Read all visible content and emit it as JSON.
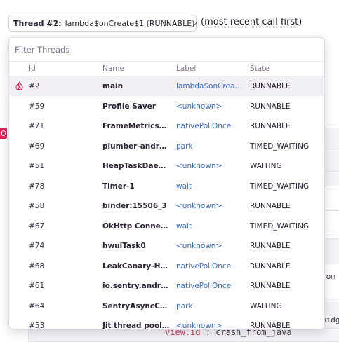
{
  "header": {
    "thread_label": "Thread #2:",
    "thread_value": "lambda$onCreate$1 (RUNNABLE)",
    "note_open": "(",
    "note_text": "most recent call first",
    "note_close": ")"
  },
  "dropdown": {
    "filter_placeholder": "Filter Threads",
    "columns": {
      "id": "Id",
      "name": "Name",
      "label": "Label",
      "state": "State"
    },
    "rows": [
      {
        "id": "#2",
        "name": "main",
        "label": "lambda$onCreate...",
        "state": "RUNNABLE",
        "icon": "flame-icon"
      },
      {
        "id": "#59",
        "name": "Profile Saver",
        "label": "<unknown>",
        "state": "RUNNABLE"
      },
      {
        "id": "#71",
        "name": "FrameMetricsAg...",
        "label": "nativePollOnce",
        "state": "RUNNABLE"
      },
      {
        "id": "#69",
        "name": "plumber-android...",
        "label": "park",
        "state": "TIMED_WAITING"
      },
      {
        "id": "#51",
        "name": "HeapTaskDaemon",
        "label": "<unknown>",
        "state": "WAITING"
      },
      {
        "id": "#78",
        "name": "Timer-1",
        "label": "wait",
        "state": "TIMED_WAITING"
      },
      {
        "id": "#58",
        "name": "binder:15506_3",
        "label": "<unknown>",
        "state": "RUNNABLE"
      },
      {
        "id": "#67",
        "name": "OkHttp Connecti...",
        "label": "wait",
        "state": "TIMED_WAITING"
      },
      {
        "id": "#74",
        "name": "hwuiTask0",
        "label": "<unknown>",
        "state": "RUNNABLE"
      },
      {
        "id": "#68",
        "name": "LeakCanary-Hea...",
        "label": "nativePollOnce",
        "state": "RUNNABLE"
      },
      {
        "id": "#61",
        "name": "io.sentry.android...",
        "label": "nativePollOnce",
        "state": "RUNNABLE"
      },
      {
        "id": "#64",
        "name": "SentryAsyncCon...",
        "label": "park",
        "state": "WAITING"
      },
      {
        "id": "#53",
        "name": "Jit thread pool w...",
        "label": "<unknown>",
        "state": "RUNNABLE"
      }
    ]
  },
  "background": {
    "frag_rom": "rom",
    "frag_widg": "widg",
    "code_key": "view.id",
    "code_sep": " : ",
    "code_val": "crash_from_java"
  },
  "colors": {
    "accent_link": "#3b6ecc",
    "flame": "#e1245a",
    "text": "#2b2233",
    "muted": "#80708f"
  }
}
